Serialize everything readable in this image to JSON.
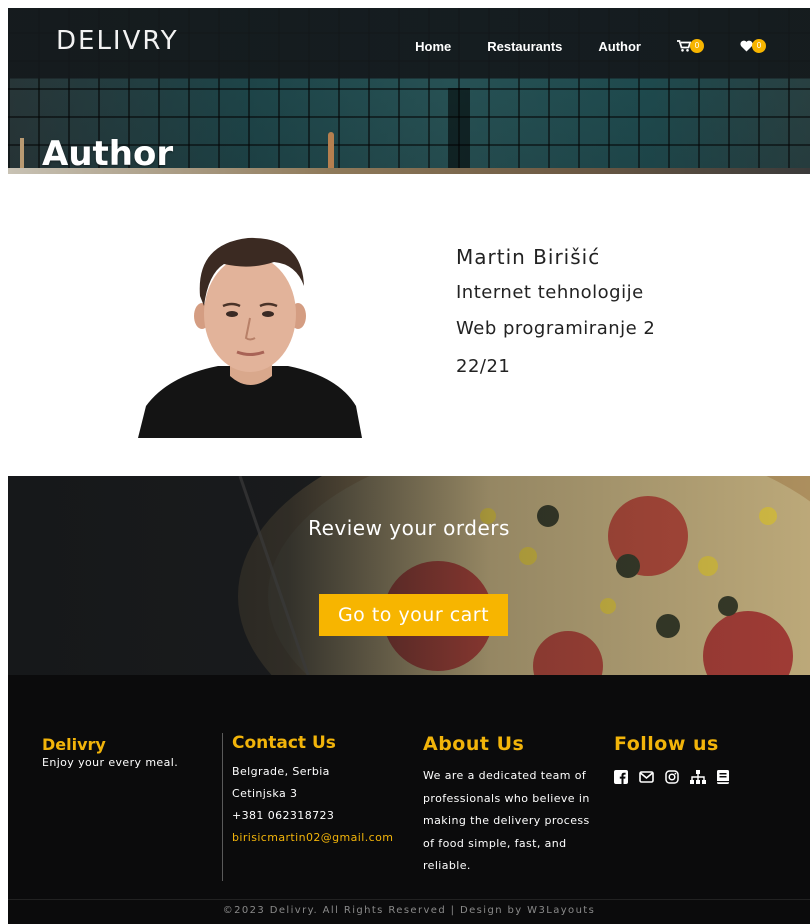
{
  "header": {
    "brand": "DELIVRY",
    "nav": [
      {
        "label": "Home"
      },
      {
        "label": "Restaurants"
      },
      {
        "label": "Author"
      }
    ],
    "cart_count": "0",
    "favorites_count": "0"
  },
  "hero": {
    "title": "Author"
  },
  "author": {
    "name": "Martin Birišić",
    "course": "Internet tehnologije",
    "subject": "Web programiranje 2",
    "index": "22/21"
  },
  "cta": {
    "title": "Review your orders",
    "button_label": "Go to your cart"
  },
  "footer": {
    "brand": {
      "title": "Delivry",
      "tagline": "Enjoy your every meal."
    },
    "contact": {
      "title": "Contact Us",
      "city": "Belgrade, Serbia",
      "street": "Cetinjska 3",
      "phone": "+381 062318723",
      "email": "birisicmartin02@gmail.com"
    },
    "about": {
      "title": "About Us",
      "text": "We are a dedicated team of professionals who believe in making the delivery process of food simple, fast, and reliable."
    },
    "follow": {
      "title": "Follow us",
      "icons": [
        "facebook-icon",
        "envelope-icon",
        "instagram-icon",
        "sitemap-icon",
        "book-icon"
      ]
    },
    "copyright": "©2023 Delivry. All Rights Reserved | Design by W3Layouts"
  },
  "colors": {
    "accent": "#f7b500",
    "footer_bg": "#0b0b0c",
    "header_bg": "#14191c"
  }
}
